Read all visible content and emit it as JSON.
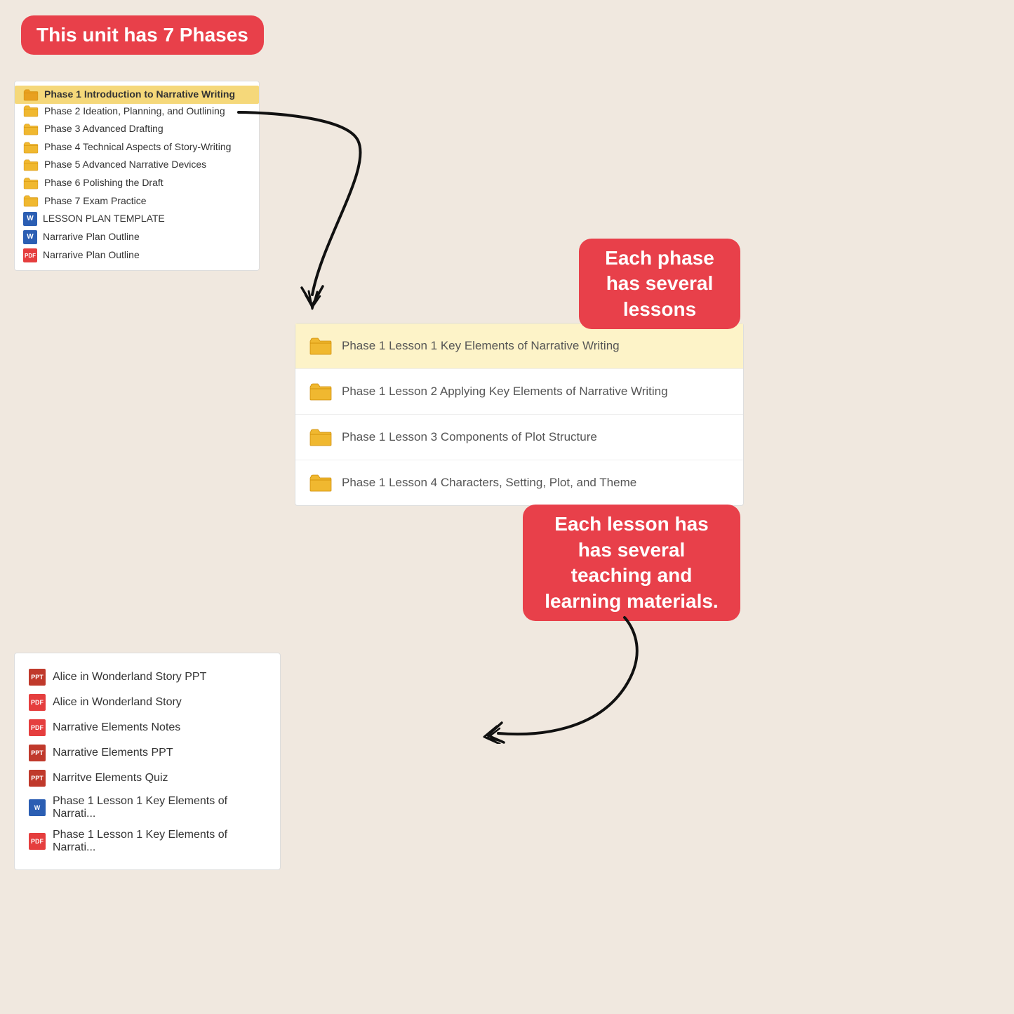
{
  "badge_top": "This unit has 7 Phases",
  "badge_right": "Each phase has several lessons",
  "badge_bottom_right": "Each lesson has has several teaching and learning materials.",
  "phase_list": {
    "items": [
      {
        "type": "folder",
        "text": "Phase 1 Introduction to Narrative Writing",
        "highlighted": true
      },
      {
        "type": "folder",
        "text": "Phase 2 Ideation, Planning, and Outlining",
        "highlighted": false
      },
      {
        "type": "folder",
        "text": "Phase 3 Advanced Drafting",
        "highlighted": false
      },
      {
        "type": "folder",
        "text": "Phase 4 Technical Aspects of Story-Writing",
        "highlighted": false
      },
      {
        "type": "folder",
        "text": "Phase 5 Advanced Narrative Devices",
        "highlighted": false
      },
      {
        "type": "folder",
        "text": "Phase 6 Polishing the Draft",
        "highlighted": false
      },
      {
        "type": "folder",
        "text": "Phase 7 Exam Practice",
        "highlighted": false
      },
      {
        "type": "word",
        "text": "LESSON PLAN TEMPLATE",
        "highlighted": false
      },
      {
        "type": "word",
        "text": "Narrarive Plan Outline",
        "highlighted": false
      },
      {
        "type": "pdf",
        "text": "Narrarive Plan Outline",
        "highlighted": false
      }
    ]
  },
  "lessons": {
    "items": [
      {
        "text": "Phase 1 Lesson 1 Key Elements of Narrative Writing",
        "highlighted": true
      },
      {
        "text": "Phase 1 Lesson 2 Applying Key Elements of Narrative Writing",
        "highlighted": false
      },
      {
        "text": "Phase 1 Lesson 3 Components of Plot Structure",
        "highlighted": false
      },
      {
        "text": "Phase 1 Lesson 4 Characters, Setting, Plot, and Theme",
        "highlighted": false
      }
    ]
  },
  "materials": {
    "items": [
      {
        "type": "ppt",
        "text": "Alice in Wonderland Story PPT"
      },
      {
        "type": "pdf",
        "text": "Alice in Wonderland Story"
      },
      {
        "type": "pdf",
        "text": "Narrative Elements Notes"
      },
      {
        "type": "ppt",
        "text": "Narrative Elements PPT"
      },
      {
        "type": "ppt",
        "text": "Narritve Elements Quiz"
      },
      {
        "type": "word",
        "text": "Phase 1 Lesson 1 Key Elements of Narrati..."
      },
      {
        "type": "pdf",
        "text": "Phase 1 Lesson 1 Key Elements of Narrati..."
      }
    ]
  }
}
